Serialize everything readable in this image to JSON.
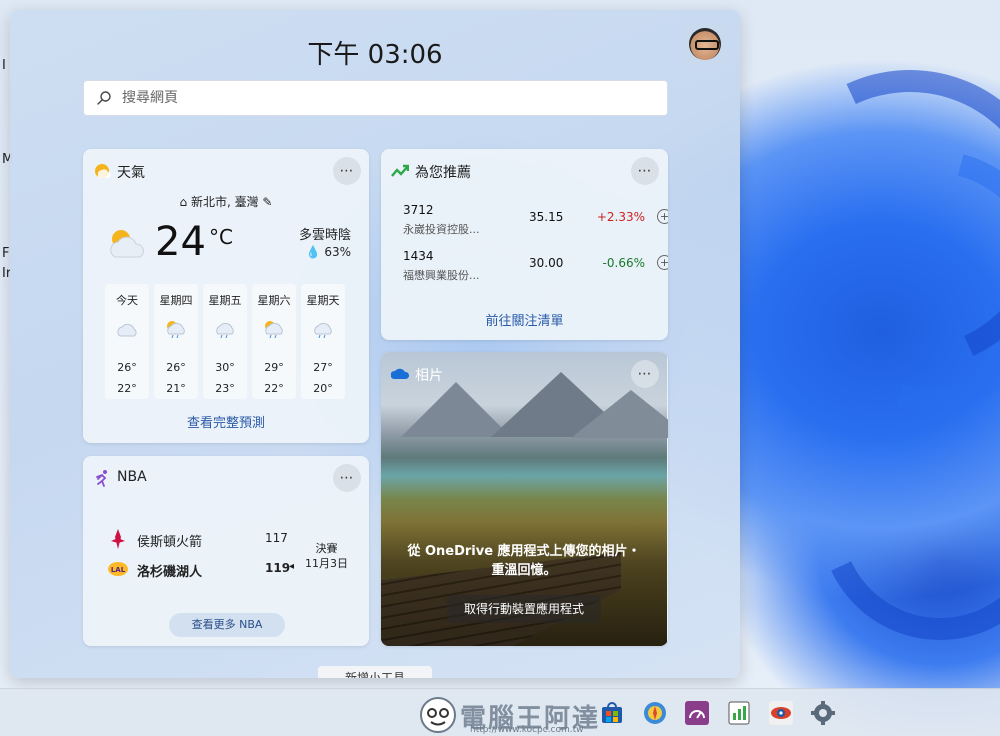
{
  "desktop": {
    "left_labels": [
      "I",
      "M",
      "F",
      "Ir"
    ]
  },
  "board": {
    "clock": "下午 03:06",
    "search_placeholder": "搜尋網頁",
    "add_widget_label": "新增小工具"
  },
  "weather": {
    "title": "天氣",
    "location": "新北市, 臺灣",
    "temperature": "24",
    "unit": "°C",
    "condition": "多雲時陰",
    "rain_chance": "63%",
    "forecast": [
      {
        "day": "今天",
        "high": "26°",
        "low": "22°",
        "icon": "cloud-icon"
      },
      {
        "day": "星期四",
        "high": "26°",
        "low": "21°",
        "icon": "partly-sunny-rain-icon"
      },
      {
        "day": "星期五",
        "high": "30°",
        "low": "23°",
        "icon": "rain-cloud-icon"
      },
      {
        "day": "星期六",
        "high": "29°",
        "low": "22°",
        "icon": "partly-sunny-rain-icon"
      },
      {
        "day": "星期天",
        "high": "27°",
        "low": "20°",
        "icon": "rain-cloud-icon"
      }
    ],
    "link": "查看完整預測"
  },
  "stocks": {
    "title": "為您推薦",
    "items": [
      {
        "symbol": "3712",
        "name": "永崴投資控股...",
        "price": "35.15",
        "change": "+2.33%",
        "direction": "up"
      },
      {
        "symbol": "1434",
        "name": "福懋興業股份...",
        "price": "30.00",
        "change": "-0.66%",
        "direction": "down"
      }
    ],
    "link": "前往關注清單"
  },
  "photos": {
    "title": "相片",
    "caption": "從 OneDrive 應用程式上傳您的相片・重溫回憶。",
    "button": "取得行動裝置應用程式"
  },
  "nba": {
    "title": "NBA",
    "teams": [
      {
        "name": "侯斯頓火箭",
        "score": "117"
      },
      {
        "name": "洛杉磯湖人",
        "score": "119"
      }
    ],
    "game_status": "決賽",
    "game_date": "11月3日",
    "link": "查看更多 NBA"
  },
  "colors": {
    "accent_link": "#2a5aa8",
    "stock_up": "#cc2222",
    "stock_down": "#1a7a2a"
  },
  "watermark": {
    "text": "電腦王阿達",
    "url": "http://www.kocpc.com.tw"
  }
}
